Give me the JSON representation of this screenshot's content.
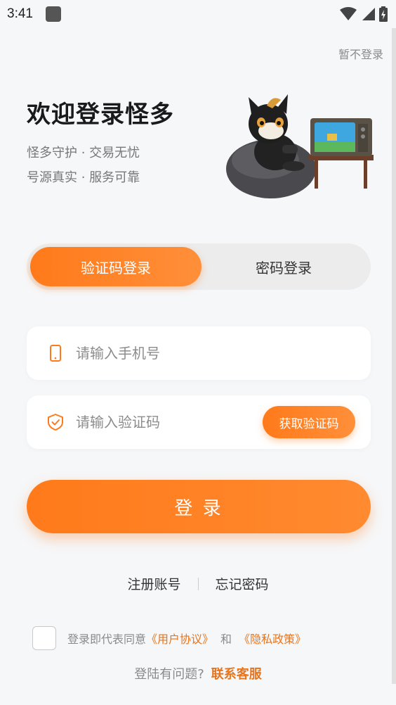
{
  "status_bar": {
    "time": "3:41"
  },
  "header": {
    "skip_label": "暂不登录"
  },
  "welcome": {
    "title": "欢迎登录怪多",
    "subtitle1": "怪多守护 · 交易无忧",
    "subtitle2": "号源真实 · 服务可靠"
  },
  "tabs": [
    {
      "label": "验证码登录",
      "active": true
    },
    {
      "label": "密码登录",
      "active": false
    }
  ],
  "phone_field": {
    "placeholder": "请输入手机号",
    "value": ""
  },
  "code_field": {
    "placeholder": "请输入验证码",
    "value": "",
    "get_code_label": "获取验证码"
  },
  "login_button": {
    "label": "登 录"
  },
  "links": {
    "register": "注册账号",
    "forgot": "忘记密码"
  },
  "agreement": {
    "prefix": "登录即代表同意",
    "user_agreement": "《用户协议》",
    "conj": "和",
    "privacy_policy": "《隐私政策》",
    "checked": false
  },
  "help": {
    "question": "登陆有问题?",
    "contact": "联系客服"
  },
  "colors": {
    "accent": "#ff7a1a",
    "link": "#e8741c",
    "background": "#f6f7f9"
  }
}
